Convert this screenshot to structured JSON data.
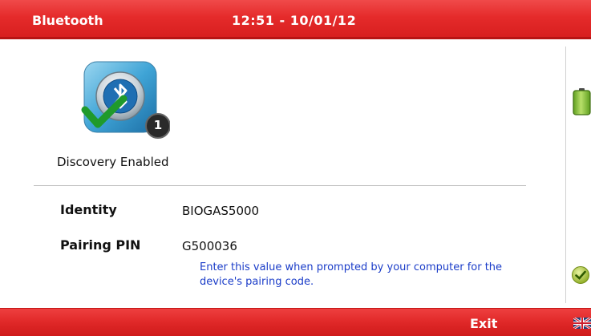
{
  "header": {
    "title": "Bluetooth",
    "clock": "12:51 - 10/01/12"
  },
  "device": {
    "status": "Discovery Enabled",
    "badge_count": "1",
    "identity_label": "Identity",
    "identity_value": "BIOGAS5000",
    "pin_label": "Pairing PIN",
    "pin_value": "G500036",
    "pin_note": "Enter this value when prompted by your computer for the device's pairing code."
  },
  "footer": {
    "exit_label": "Exit"
  },
  "side_icons": {
    "battery": "battery-full-icon",
    "status": "check-ok-icon",
    "language": "uk-flag-icon"
  },
  "colors": {
    "bar_red": "#e52b2b",
    "note_blue": "#1a3cc8",
    "battery_green": "#8cc63f"
  }
}
